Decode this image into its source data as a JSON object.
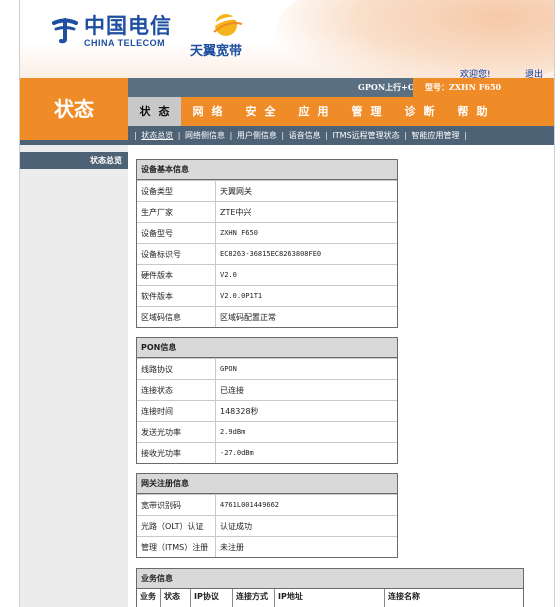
{
  "header": {
    "brand_cn": "中国电信",
    "brand_en": "CHINA TELECOM",
    "broadband_brand": "天翼宽带",
    "welcome": "欢迎您!",
    "logout": "退出"
  },
  "left_title": "状态",
  "infobar": {
    "gpon_label": "GPON上行+O-C",
    "model": "型号：ZXHN F650"
  },
  "mainnav": [
    "状态",
    "网络",
    "安全",
    "应用",
    "管理",
    "诊断",
    "帮助"
  ],
  "subnav": [
    "状态总览",
    "网络侧信息",
    "用户侧信息",
    "语音信息",
    "ITMS远程管理状态",
    "智能应用管理"
  ],
  "sidebar": {
    "item": "状态总览"
  },
  "sections": {
    "device": {
      "title": "设备基本信息",
      "rows": [
        {
          "label": "设备类型",
          "value": "天翼网关"
        },
        {
          "label": "生产厂家",
          "value": "ZTE中兴"
        },
        {
          "label": "设备型号",
          "value": "ZXHN F650"
        },
        {
          "label": "设备标识号",
          "value": "EC8263-36815EC8263808FE0"
        },
        {
          "label": "硬件版本",
          "value": "V2.0"
        },
        {
          "label": "软件版本",
          "value": "V2.0.0P1T1"
        },
        {
          "label": "区域码信息",
          "value": "区域码配置正常"
        }
      ]
    },
    "pon": {
      "title": "PON信息",
      "rows": [
        {
          "label": "线路协议",
          "value": "GPON"
        },
        {
          "label": "连接状态",
          "value": "已连接"
        },
        {
          "label": "连接时间",
          "value": "148328秒"
        },
        {
          "label": "发送光功率",
          "value": "2.9dBm"
        },
        {
          "label": "接收光功率",
          "value": "-27.0dBm"
        }
      ]
    },
    "gateway": {
      "title": "网关注册信息",
      "rows": [
        {
          "label": "宽带识别码",
          "value": "4761L001449662"
        },
        {
          "label": "光路（OLT）认证",
          "value": "认证成功"
        },
        {
          "label": "管理（ITMS）注册",
          "value": "未注册"
        }
      ]
    },
    "business": {
      "title": "业务信息",
      "columns": [
        "业务",
        "状态",
        "IP协议",
        "连接方式",
        "IP地址",
        "连接名称"
      ]
    }
  },
  "colors": {
    "orange": "#f08c28",
    "slate": "#4e6275",
    "brand_blue": "#1e4fa0"
  }
}
